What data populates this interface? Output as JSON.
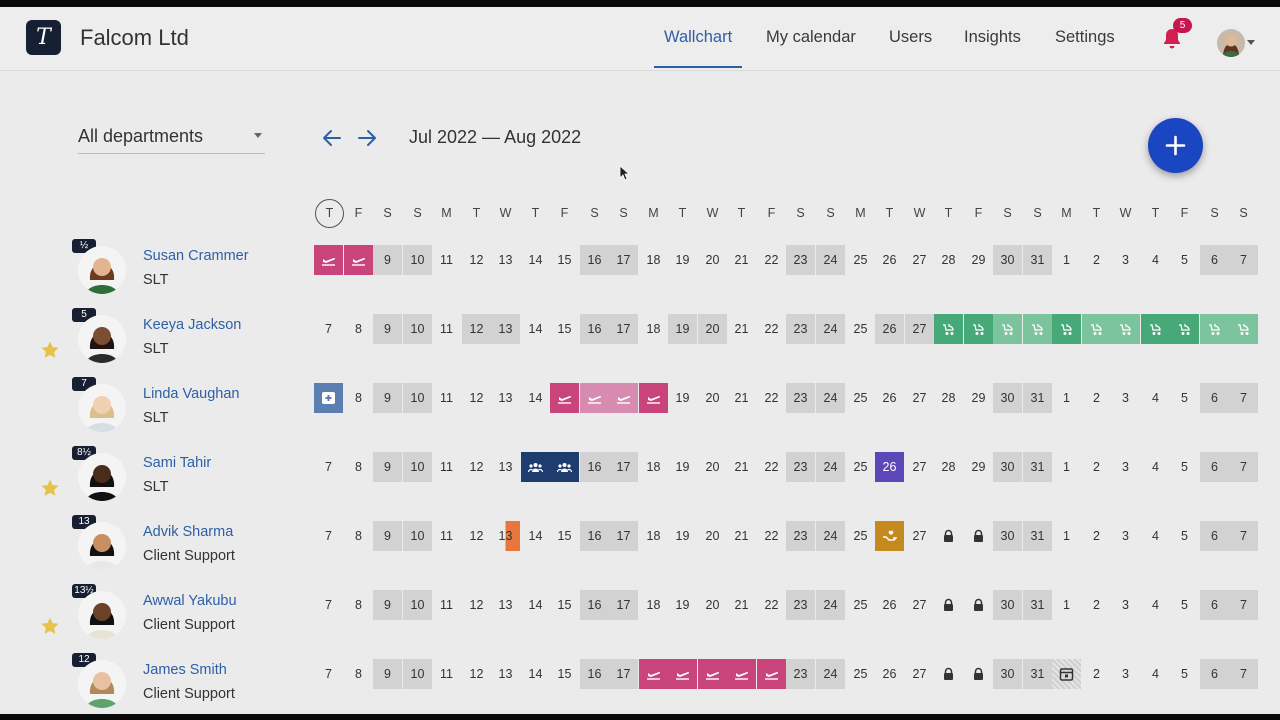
{
  "header": {
    "company": "Falcom Ltd",
    "logo_letter": "T",
    "nav": [
      {
        "label": "Wallchart",
        "active": true
      },
      {
        "label": "My calendar",
        "active": false
      },
      {
        "label": "Users",
        "active": false
      },
      {
        "label": "Insights",
        "active": false
      },
      {
        "label": "Settings",
        "active": false
      }
    ],
    "notifications_count": "5",
    "accent_color": "#2d5fa6",
    "badge_color": "#c8144f"
  },
  "toolbar": {
    "department": "All departments",
    "date_range": "Jul 2022 — Aug 2022",
    "prev_icon": "arrow-left-icon",
    "next_icon": "arrow-right-icon",
    "add_icon": "plus-icon"
  },
  "calendar": {
    "weekday_headers": [
      "T",
      "F",
      "S",
      "S",
      "M",
      "T",
      "W",
      "T",
      "F",
      "S",
      "S",
      "M",
      "T",
      "W",
      "T",
      "F",
      "S",
      "S",
      "M",
      "T",
      "W",
      "T",
      "F",
      "S",
      "S",
      "M",
      "T",
      "W",
      "T",
      "F",
      "S",
      "S"
    ],
    "today_index": 0,
    "day_numbers": [
      "7",
      "8",
      "9",
      "10",
      "11",
      "12",
      "13",
      "14",
      "15",
      "16",
      "17",
      "18",
      "19",
      "20",
      "21",
      "22",
      "23",
      "24",
      "25",
      "26",
      "27",
      "28",
      "29",
      "30",
      "31",
      "1",
      "2",
      "3",
      "4",
      "5",
      "6",
      "7"
    ],
    "weekend_indices": [
      2,
      3,
      9,
      10,
      16,
      17,
      23,
      24,
      30,
      31
    ],
    "colors": {
      "vacation": "#c9447a",
      "vacation_light": "#d88bb0",
      "parental": "#47a878",
      "parental_light": "#7cc49d",
      "sick": "#5a7fb0",
      "meeting": "#1f3c6e",
      "purple": "#5c47b8",
      "orange": "#e8763f",
      "gold": "#c48a1f"
    }
  },
  "users": [
    {
      "name": "Susan Crammer",
      "team": "SLT",
      "allowance": "½",
      "starred": false,
      "events": [
        {
          "i": 0,
          "icon": "plane-icon",
          "color": "vacation"
        },
        {
          "i": 1,
          "icon": "plane-icon",
          "color": "vacation"
        }
      ],
      "extra_shaded": []
    },
    {
      "name": "Keeya Jackson",
      "team": "SLT",
      "allowance": "5",
      "starred": true,
      "events": [
        {
          "i": 21,
          "icon": "stroller-icon",
          "color": "parental"
        },
        {
          "i": 22,
          "icon": "stroller-icon",
          "color": "parental"
        },
        {
          "i": 23,
          "icon": "stroller-icon",
          "color": "parental_light"
        },
        {
          "i": 24,
          "icon": "stroller-icon",
          "color": "parental_light"
        },
        {
          "i": 25,
          "icon": "stroller-icon",
          "color": "parental"
        },
        {
          "i": 26,
          "icon": "stroller-icon",
          "color": "parental_light"
        },
        {
          "i": 27,
          "icon": "stroller-icon",
          "color": "parental_light"
        },
        {
          "i": 28,
          "icon": "stroller-icon",
          "color": "parental"
        },
        {
          "i": 29,
          "icon": "stroller-icon",
          "color": "parental"
        },
        {
          "i": 30,
          "icon": "stroller-icon",
          "color": "parental_light"
        },
        {
          "i": 31,
          "icon": "stroller-icon",
          "color": "parental_light"
        }
      ],
      "extra_shaded": [
        5,
        6,
        12,
        13,
        19,
        20
      ]
    },
    {
      "name": "Linda Vaughan",
      "team": "SLT",
      "allowance": "7",
      "starred": false,
      "events": [
        {
          "i": 0,
          "icon": "medical-icon",
          "color": "sick"
        },
        {
          "i": 8,
          "icon": "plane-icon",
          "color": "vacation"
        },
        {
          "i": 9,
          "icon": "plane-icon",
          "color": "vacation_light"
        },
        {
          "i": 10,
          "icon": "plane-icon",
          "color": "vacation_light"
        },
        {
          "i": 11,
          "icon": "plane-icon",
          "color": "vacation"
        }
      ],
      "extra_shaded": []
    },
    {
      "name": "Sami Tahir",
      "team": "SLT",
      "allowance": "8½",
      "starred": true,
      "events": [
        {
          "i": 7,
          "icon": "group-icon",
          "color": "meeting"
        },
        {
          "i": 8,
          "icon": "group-icon",
          "color": "meeting"
        },
        {
          "i": 19,
          "text": "26",
          "color": "purple"
        }
      ],
      "extra_shaded": []
    },
    {
      "name": "Advik Sharma",
      "team": "Client Support",
      "allowance": "13",
      "starred": false,
      "events": [
        {
          "i": 6,
          "text": "13",
          "color": "orange",
          "half": true
        },
        {
          "i": 19,
          "icon": "care-icon",
          "color": "gold"
        },
        {
          "i": 21,
          "icon": "lock-icon",
          "color": "none"
        },
        {
          "i": 22,
          "icon": "lock-icon",
          "color": "none"
        }
      ],
      "extra_shaded": []
    },
    {
      "name": "Awwal Yakubu",
      "team": "Client Support",
      "allowance": "13½",
      "starred": true,
      "events": [
        {
          "i": 21,
          "icon": "lock-icon",
          "color": "none"
        },
        {
          "i": 22,
          "icon": "lock-icon",
          "color": "none"
        }
      ],
      "extra_shaded": []
    },
    {
      "name": "James Smith",
      "team": "Client Support",
      "allowance": "12",
      "starred": false,
      "events": [
        {
          "i": 11,
          "icon": "plane-icon",
          "color": "vacation"
        },
        {
          "i": 12,
          "icon": "plane-icon",
          "color": "vacation"
        },
        {
          "i": 13,
          "icon": "plane-icon",
          "color": "vacation"
        },
        {
          "i": 14,
          "icon": "plane-icon",
          "color": "vacation"
        },
        {
          "i": 15,
          "icon": "plane-icon",
          "color": "vacation"
        },
        {
          "i": 21,
          "icon": "lock-icon",
          "color": "none"
        },
        {
          "i": 22,
          "icon": "lock-icon",
          "color": "none"
        },
        {
          "i": 25,
          "icon": "calendar-icon",
          "color": "none",
          "hatched": true
        }
      ],
      "extra_shaded": []
    }
  ]
}
